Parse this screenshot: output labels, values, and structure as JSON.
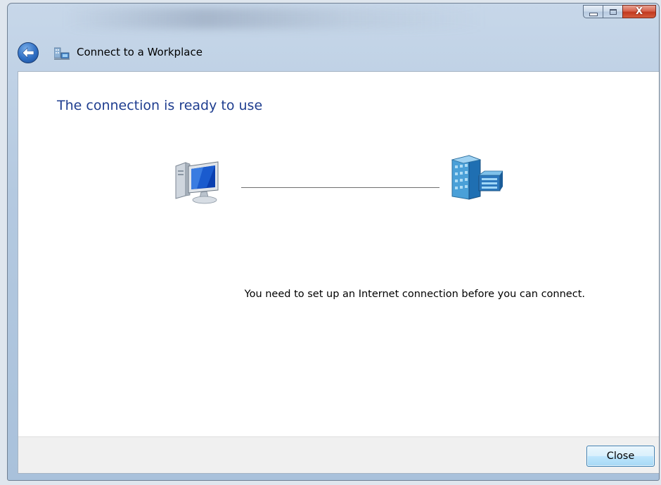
{
  "window": {
    "caption_buttons": {
      "minimize_icon": "minimize-icon",
      "maximize_icon": "maximize-icon",
      "close_icon": "close-icon",
      "close_glyph": "X"
    }
  },
  "nav": {
    "back_icon": "back-arrow-icon",
    "wizard_icon": "network-workplace-icon",
    "title": "Connect to a Workplace"
  },
  "main": {
    "heading": "The connection is ready to use",
    "computer_icon": "computer-icon",
    "server_icon": "workplace-server-icon",
    "message": "You need to set up an Internet connection before you can connect."
  },
  "footer": {
    "close_label": "Close"
  },
  "colors": {
    "heading": "#1e3d8f",
    "content_bg": "#ffffff",
    "footer_bg": "#f0f0f0",
    "button_border": "#3c7fb1"
  }
}
